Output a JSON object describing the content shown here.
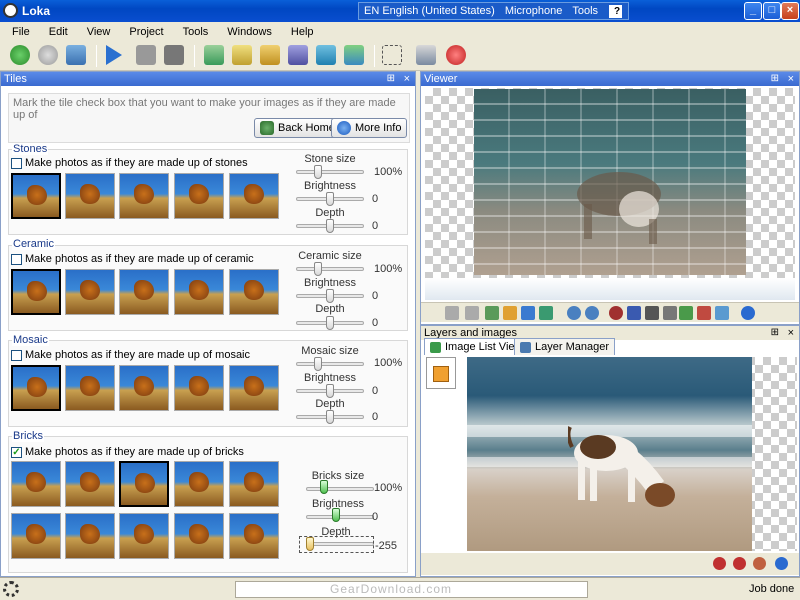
{
  "window": {
    "title": "Loka",
    "language": "EN English (United States)",
    "microphone": "Microphone",
    "tools": "Tools",
    "help": "?",
    "min": "_",
    "max": "□",
    "close": "×"
  },
  "menu": [
    "File",
    "Edit",
    "View",
    "Project",
    "Tools",
    "Windows",
    "Help"
  ],
  "tiles_panel": {
    "title": "Tiles",
    "pin": "⊞",
    "close": "×",
    "hint": "Mark the tile check box that you want to make your images as if they are made up of",
    "back_home": "Back Home",
    "more_info": "More Info",
    "groups": [
      {
        "title": "Stones",
        "checkbox": "Make photos as if they are made up of stones",
        "checked": false,
        "sliders": [
          {
            "label": "Stone size",
            "value": "100%"
          },
          {
            "label": "Brightness",
            "value": "0"
          },
          {
            "label": "Depth",
            "value": "0"
          }
        ]
      },
      {
        "title": "Ceramic",
        "checkbox": "Make photos as if they are made up of ceramic",
        "checked": false,
        "sliders": [
          {
            "label": "Ceramic size",
            "value": "100%"
          },
          {
            "label": "Brightness",
            "value": "0"
          },
          {
            "label": "Depth",
            "value": "0"
          }
        ]
      },
      {
        "title": "Mosaic",
        "checkbox": "Make photos as if they are made up of mosaic",
        "checked": false,
        "sliders": [
          {
            "label": "Mosaic size",
            "value": "100%"
          },
          {
            "label": "Brightness",
            "value": "0"
          },
          {
            "label": "Depth",
            "value": "0"
          }
        ]
      },
      {
        "title": "Bricks",
        "checkbox": "Make photos as if they are made up of bricks",
        "checked": true,
        "sliders": [
          {
            "label": "Bricks size",
            "value": "100%"
          },
          {
            "label": "Brightness",
            "value": "0"
          },
          {
            "label": "Depth",
            "value": "-255"
          }
        ]
      }
    ]
  },
  "viewer_panel": {
    "title": "Viewer",
    "pin": "⊞",
    "close": "×"
  },
  "layers_panel": {
    "title": "Layers and images",
    "pin": "⊞",
    "close": "×",
    "tabs": [
      "Image List Viewer",
      "Layer Manager"
    ]
  },
  "status": {
    "watermark": "GearDownload.com",
    "text": "Job done"
  }
}
